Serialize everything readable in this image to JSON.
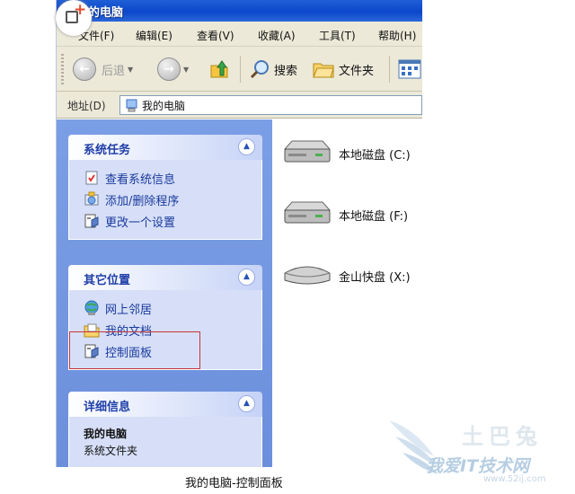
{
  "window": {
    "title": "我的电脑"
  },
  "menu": [
    {
      "label": "文件(F)"
    },
    {
      "label": "编辑(E)"
    },
    {
      "label": "查看(V)"
    },
    {
      "label": "收藏(A)"
    },
    {
      "label": "工具(T)"
    },
    {
      "label": "帮助(H)"
    }
  ],
  "toolbar": {
    "back_label": "后退",
    "search_label": "搜索",
    "folders_label": "文件夹"
  },
  "address": {
    "label": "地址(D)",
    "value": "我的电脑"
  },
  "tasks": {
    "title": "系统任务",
    "items": [
      {
        "label": "查看系统信息"
      },
      {
        "label": "添加/删除程序"
      },
      {
        "label": "更改一个设置"
      }
    ]
  },
  "places": {
    "title": "其它位置",
    "items": [
      {
        "label": "网上邻居"
      },
      {
        "label": "我的文档"
      },
      {
        "label": "控制面板"
      }
    ]
  },
  "details": {
    "title": "详细信息",
    "name": "我的电脑",
    "type": "系统文件夹"
  },
  "drives": [
    {
      "label": "本地磁盘 (C:)"
    },
    {
      "label": "本地磁盘 (F:)"
    },
    {
      "label": "金山快盘 (X:)"
    }
  ],
  "caption": "我的电脑-控制面板",
  "watermark": {
    "line1": "土巴兔",
    "line2": "我爱IT技术网",
    "line3": "www.52ij.com"
  },
  "colors": {
    "title_bar": "#0b47c9",
    "task_pane": "#7b9fe6",
    "panel_body": "#d6dff7",
    "highlight_box": "#c8343c"
  }
}
